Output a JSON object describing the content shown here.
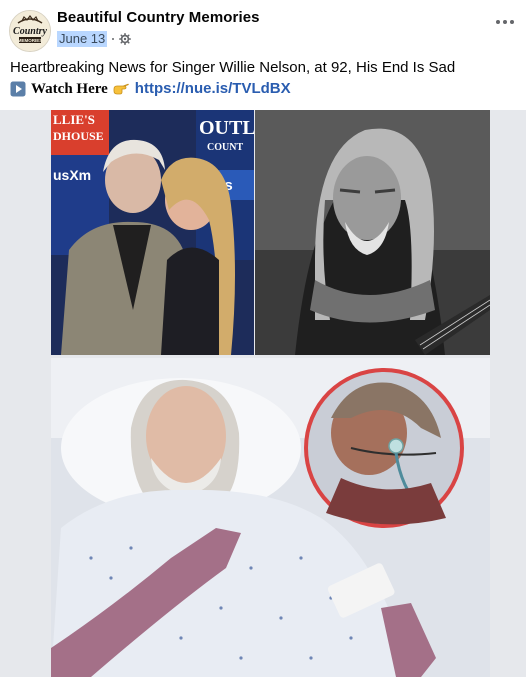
{
  "post": {
    "page_name": "Beautiful Country Memories",
    "date": "June 13",
    "text_line1": "Heartbreaking News for Singer Willie Nelson, at 92, His End Is Sad",
    "watch_label": "Watch Here",
    "link_text": "https://nue.is/TVLdBX"
  },
  "avatar_logo": {
    "word1": "Country",
    "word2": "MEMORIES"
  },
  "photo_signs": {
    "left_top": "LLIE'S",
    "left_mid": "DHOUSE",
    "left_radio": "usXm",
    "right_top": "OUTL",
    "right_mid": "COUNT",
    "right_radio": "irius"
  },
  "icons": {
    "privacy": "gear-icon",
    "more": "more-options-icon",
    "play": "play-button-icon",
    "pointing": "pointing-hand-icon"
  }
}
